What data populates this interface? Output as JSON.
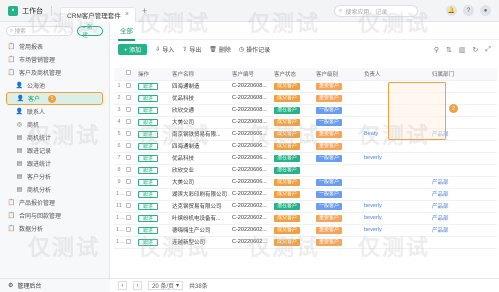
{
  "topbar": {
    "app_title": "工作台",
    "tab_label": "CRM客户管理套件",
    "search_placeholder": "搜索应用、记录"
  },
  "sidebar": {
    "search_placeholder": "搜索",
    "new_label": "+ 新建",
    "items": [
      {
        "label": "常用报表",
        "icon": "📋"
      },
      {
        "label": "市场营销管理",
        "icon": "📋"
      },
      {
        "label": "客户及商机管理",
        "icon": "📋"
      },
      {
        "label": "公海池",
        "icon": "👤",
        "sub": true
      },
      {
        "label": "客户",
        "icon": "👤",
        "sub": true,
        "active": true
      },
      {
        "label": "联系人",
        "icon": "👤",
        "sub": true
      },
      {
        "label": "商机",
        "icon": "◎",
        "sub": true
      },
      {
        "label": "商机统计",
        "icon": "▤",
        "sub": true
      },
      {
        "label": "跟进记录",
        "icon": "▤",
        "sub": true
      },
      {
        "label": "跟进统计",
        "icon": "▤",
        "sub": true
      },
      {
        "label": "客户分析",
        "icon": "▤",
        "sub": true
      },
      {
        "label": "商机分析",
        "icon": "▤",
        "sub": true
      },
      {
        "label": "产品报价管理",
        "icon": "📋"
      },
      {
        "label": "合同与回款管理",
        "icon": "📋"
      },
      {
        "label": "数据分析",
        "icon": "📋"
      }
    ],
    "active_badge": "1",
    "footer": "管理后台"
  },
  "main": {
    "tab": "全部",
    "toolbar": {
      "add": "+ 添加",
      "import": "导入",
      "export": "导出",
      "delete": "删除",
      "oplog": "操作记录"
    },
    "columns": [
      "",
      "",
      "操作",
      "客户名称",
      "客户编号",
      "客户状态",
      "客户级别",
      "负责人",
      "",
      "归属部门"
    ],
    "rows": [
      {
        "idx": "1",
        "op": "跟进",
        "name": "四海通制造",
        "code": "C-20220608...",
        "status": "成交客户",
        "status_c": "orange",
        "level": "重要客户",
        "level_c": "orange",
        "owner": "",
        "dept": ""
      },
      {
        "idx": "2",
        "op": "跟进",
        "name": "优品科技",
        "code": "C-20220608...",
        "status": "成交客户",
        "status_c": "orange",
        "level": "重要客户",
        "level_c": "orange",
        "owner": "",
        "dept": ""
      },
      {
        "idx": "3",
        "op": "跟进",
        "name": "欣欣交通",
        "code": "C-20220608...",
        "status": "潜在客户",
        "status_c": "green",
        "level": "一般客户",
        "level_c": "blue",
        "owner": "",
        "dept": ""
      },
      {
        "idx": "4",
        "op": "跟进",
        "name": "大美公司",
        "code": "C-20220608...",
        "status": "成交客户",
        "status_c": "orange",
        "level": "一般客户",
        "level_c": "blue",
        "owner": "",
        "dept": ""
      },
      {
        "idx": "5",
        "op": "跟进",
        "name": "南京钢铁贸易有限...",
        "code": "C-20220606...",
        "status": "成交客户",
        "status_c": "orange",
        "level": "重要客户",
        "level_c": "orange",
        "owner": "Beaty",
        "dept": "产品部"
      },
      {
        "idx": "6",
        "op": "跟进",
        "name": "四海通制造",
        "code": "C-20220606...",
        "status": "成交客户",
        "status_c": "orange",
        "level": "重要客户",
        "level_c": "orange",
        "owner": "",
        "dept": ""
      },
      {
        "idx": "7",
        "op": "跟进",
        "name": "优品科技",
        "code": "C-20220606...",
        "status": "潜在客户",
        "status_c": "green",
        "level": "一般客户",
        "level_c": "blue",
        "owner": "beverly",
        "dept": ""
      },
      {
        "idx": "8",
        "op": "跟进",
        "name": "欣欣交业",
        "code": "C-20220606...",
        "status": "潜在客户",
        "status_c": "green",
        "level": "",
        "level_c": "",
        "owner": "",
        "dept": ""
      },
      {
        "idx": "9",
        "op": "跟进",
        "name": "大美公司",
        "code": "C-20220606...",
        "status": "成交客户",
        "status_c": "orange",
        "level": "一般客户",
        "level_c": "blue",
        "owner": "",
        "dept": "产品部"
      },
      {
        "idx": "10",
        "op": "跟进",
        "name": "湖滨大彩印刷有限公司",
        "code": "C-20220602...",
        "status": "成交客户",
        "status_c": "orange",
        "level": "一般客户",
        "level_c": "blue",
        "owner": "",
        "dept": "产品部"
      },
      {
        "idx": "11",
        "op": "跟进",
        "name": "达克钢贸易有限公司",
        "code": "C-20220602...",
        "status": "潜在客户",
        "status_c": "green",
        "level": "一般客户",
        "level_c": "blue",
        "owner": "beverly",
        "dept": "产品部"
      },
      {
        "idx": "12",
        "op": "跟进",
        "name": "叶缤纷机电设备有...",
        "code": "C-20220602...",
        "status": "成交客户",
        "status_c": "orange",
        "level": "重要客户",
        "level_c": "orange",
        "owner": "beverly",
        "dept": "产品部"
      },
      {
        "idx": "13",
        "op": "跟进",
        "name": "德嗨嗨生产公司",
        "code": "C-20220602...",
        "status": "成交客户",
        "status_c": "orange",
        "level": "重要客户",
        "level_c": "orange",
        "owner": "beverly",
        "dept": "产品部"
      },
      {
        "idx": "14",
        "op": "跟进",
        "name": "连越新型公司",
        "code": "C-20220602...",
        "status": "成交客户",
        "status_c": "orange",
        "level": "重要客户",
        "level_c": "orange",
        "owner": "",
        "dept": ""
      }
    ],
    "highlight_badge": "2",
    "pager": {
      "page_size": "20 条/页",
      "total": "共38条"
    }
  },
  "watermarks": [
    "仅测试",
    "仅测试",
    "仅测试",
    "仅测试",
    "仅测试",
    "仅测试",
    "仅测试",
    "仅测试",
    "仅测试",
    "仅测试",
    "仅测试",
    "仅测试"
  ]
}
